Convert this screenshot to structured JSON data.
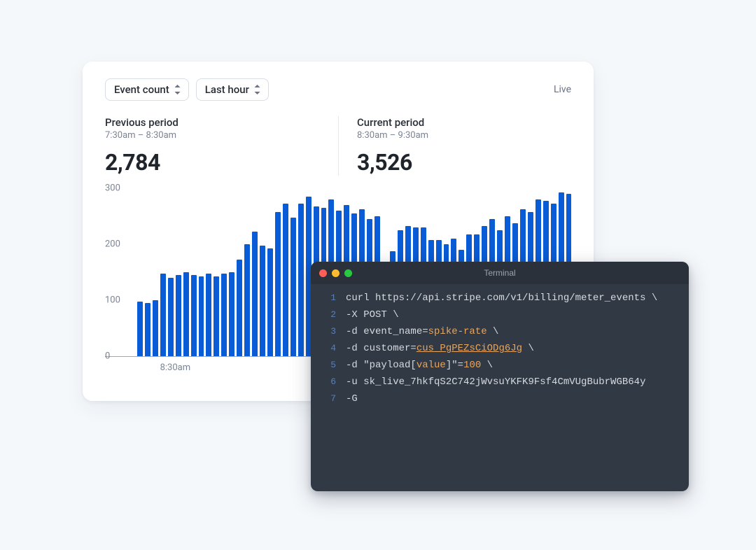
{
  "card": {
    "selectors": {
      "metric": "Event count",
      "range": "Last hour"
    },
    "status": "Live",
    "periods": [
      {
        "title": "Previous period",
        "range": "7:30am – 8:30am",
        "value": "2,784"
      },
      {
        "title": "Current period",
        "range": "8:30am – 9:30am",
        "value": "3,526"
      }
    ],
    "xaxis_label": "8:30am"
  },
  "chart_data": {
    "type": "bar",
    "ylim": [
      0,
      300
    ],
    "yticks": [
      0,
      100,
      200,
      300
    ],
    "xlabel": "",
    "ylabel": "",
    "values": [
      98,
      95,
      100,
      148,
      140,
      145,
      150,
      145,
      142,
      148,
      142,
      148,
      150,
      172,
      200,
      222,
      198,
      192,
      258,
      272,
      248,
      272,
      285,
      268,
      265,
      280,
      260,
      270,
      255,
      262,
      245,
      250,
      162,
      188,
      225,
      232,
      230,
      230,
      208,
      208,
      200,
      210,
      190,
      218,
      218,
      232,
      245,
      225,
      250,
      238,
      262,
      258,
      280,
      278,
      272,
      292,
      290
    ]
  },
  "terminal": {
    "title": "Terminal",
    "lines": [
      {
        "n": "1",
        "plain": "curl https://api.stripe.com/v1/billing/meter_events \\"
      },
      {
        "n": "2",
        "plain": "  -X POST \\"
      },
      {
        "n": "3",
        "pre": "  -d event_name=",
        "val": "spike-rate",
        "post": "  \\",
        "valClass": "val"
      },
      {
        "n": "4",
        "pre": "  -d customer=",
        "val": "cus_PgPEZsCiODg6Jg",
        "post": " \\",
        "valClass": "valu"
      },
      {
        "n": "5",
        "pre": "  -d \"payload[",
        "mid": "value",
        "pre2": "]\"=",
        "val": "100",
        "post": " \\",
        "midClass": "val",
        "valClass": "num"
      },
      {
        "n": "6",
        "plain": "  -u sk_live_7hkfqS2C742jWvsuYKFK9Fsf4CmVUgBubrWGB64y"
      },
      {
        "n": "7",
        "plain": "  -G"
      }
    ]
  }
}
